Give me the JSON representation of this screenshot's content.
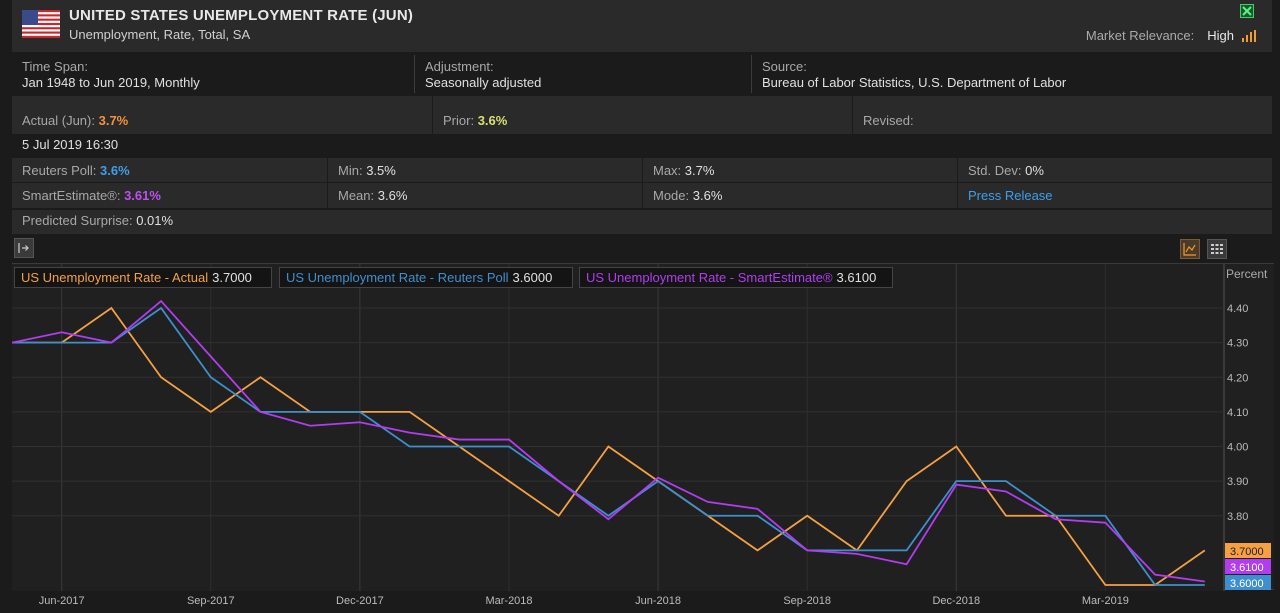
{
  "header": {
    "title": "UNITED STATES UNEMPLOYMENT RATE (JUN)",
    "subtitle": "Unemployment, Rate, Total, SA",
    "relevance_label": "Market Relevance:",
    "relevance_value": "High"
  },
  "info": {
    "time_span_label": "Time Span:",
    "time_span_value": "Jan 1948 to Jun 2019, Monthly",
    "adjustment_label": "Adjustment:",
    "adjustment_value": "Seasonally adjusted",
    "source_label": "Source:",
    "source_value": "Bureau of Labor Statistics, U.S. Department of Labor"
  },
  "release": {
    "actual_label": "Actual (Jun):",
    "actual_value": "3.7%",
    "prior_label": "Prior:",
    "prior_value": "3.6%",
    "revised_label": "Revised:",
    "revised_value": "",
    "date": "5 Jul 2019 16:30"
  },
  "stats": {
    "reuters_poll_label": "Reuters Poll:",
    "reuters_poll_value": "3.6%",
    "min_label": "Min:",
    "min_value": "3.5%",
    "max_label": "Max:",
    "max_value": "3.7%",
    "std_dev_label": "Std. Dev:",
    "std_dev_value": "0%",
    "smart_label": "SmartEstimate®:",
    "smart_value": "3.61%",
    "mean_label": "Mean:",
    "mean_value": "3.6%",
    "mode_label": "Mode:",
    "mode_value": "3.6%",
    "press_release": "Press Release",
    "predicted_label": "Predicted Surprise:",
    "predicted_value": "0.01%"
  },
  "colors": {
    "actual": "#f5a043",
    "reuters": "#3f8fce",
    "smart": "#b23cf0"
  },
  "chart_data": {
    "type": "line",
    "unit_label": "Percent",
    "x": [
      "May-2017",
      "Jun-2017",
      "Jul-2017",
      "Aug-2017",
      "Sep-2017",
      "Oct-2017",
      "Nov-2017",
      "Dec-2017",
      "Jan-2018",
      "Feb-2018",
      "Mar-2018",
      "Apr-2018",
      "May-2018",
      "Jun-2018",
      "Jul-2018",
      "Aug-2018",
      "Sep-2018",
      "Oct-2018",
      "Nov-2018",
      "Dec-2018",
      "Jan-2019",
      "Feb-2019",
      "Mar-2019",
      "Apr-2019",
      "May-2019",
      "Jun-2019"
    ],
    "x_ticks": [
      "Jun-2017",
      "Sep-2017",
      "Dec-2017",
      "Mar-2018",
      "Jun-2018",
      "Sep-2018",
      "Dec-2018",
      "Mar-2019"
    ],
    "y_ticks": [
      "4.40",
      "4.30",
      "4.20",
      "4.10",
      "4.00",
      "3.90",
      "3.80"
    ],
    "ylim": [
      3.6,
      4.4
    ],
    "series": [
      {
        "name": "US Unemployment Rate - Actual",
        "last_label": "3.7000",
        "values": [
          4.3,
          4.3,
          4.4,
          4.2,
          4.1,
          4.2,
          4.1,
          4.1,
          4.1,
          4.0,
          3.9,
          3.8,
          4.0,
          3.9,
          3.8,
          3.7,
          3.8,
          3.7,
          3.9,
          4.0,
          3.8,
          3.8,
          3.6,
          3.6,
          3.7
        ]
      },
      {
        "name": "US Unemployment Rate - Reuters Poll",
        "last_label": "3.6000",
        "values": [
          4.3,
          4.3,
          4.3,
          4.4,
          4.2,
          4.1,
          4.1,
          4.1,
          4.0,
          4.0,
          4.0,
          3.9,
          3.8,
          3.9,
          3.8,
          3.8,
          3.7,
          3.7,
          3.7,
          3.9,
          3.9,
          3.8,
          3.8,
          3.6,
          3.6
        ]
      },
      {
        "name": "US Unemployment Rate - SmartEstimate®",
        "last_label": "3.6100",
        "values": [
          4.3,
          4.33,
          4.3,
          4.42,
          4.26,
          4.1,
          4.06,
          4.07,
          4.04,
          4.02,
          4.02,
          3.9,
          3.79,
          3.91,
          3.84,
          3.82,
          3.7,
          3.69,
          3.66,
          3.89,
          3.87,
          3.79,
          3.78,
          3.63,
          3.61
        ]
      }
    ],
    "grid": true
  }
}
